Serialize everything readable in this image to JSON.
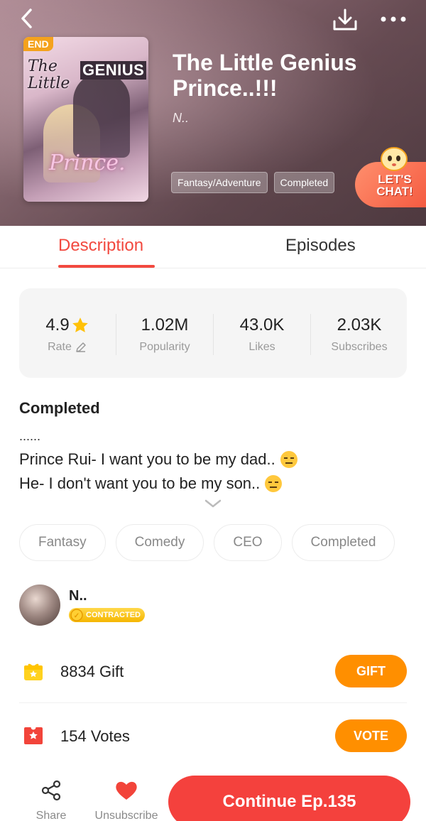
{
  "header": {
    "end_badge": "END",
    "cover_script": "The\nLittle",
    "cover_genius": "GENIUS",
    "cover_prince": "Prince.",
    "title": "The Little Genius Prince..!!!",
    "author": "N..",
    "genres": [
      "Fantasy/Adventure",
      "Completed"
    ],
    "chat_label": "LET'S CHAT!",
    "icons": [
      "back-icon",
      "download-icon",
      "more-icon"
    ]
  },
  "tabs": {
    "description": "Description",
    "episodes": "Episodes",
    "active": "Description"
  },
  "stats": {
    "rate": {
      "value": "4.9",
      "label": "Rate"
    },
    "popularity": {
      "value": "1.02M",
      "label": "Popularity"
    },
    "likes": {
      "value": "43.0K",
      "label": "Likes"
    },
    "subscribes": {
      "value": "2.03K",
      "label": "Subscribes"
    }
  },
  "description": {
    "status": "Completed",
    "dots": "......",
    "line1": "Prince Rui- I want you to be my dad..",
    "line2": "He- I don't want you to be my son.."
  },
  "tags": [
    "Fantasy",
    "Comedy",
    "CEO",
    "Completed"
  ],
  "author": {
    "name": "N..",
    "badge": "CONTRACTED"
  },
  "gift": {
    "label": "8834 Gift",
    "button": "GIFT"
  },
  "vote": {
    "label": "154 Votes",
    "button": "VOTE"
  },
  "bottom": {
    "share": "Share",
    "unsubscribe": "Unsubscribe",
    "continue": "Continue Ep.135"
  },
  "colors": {
    "accent": "#f2493f",
    "orange": "#ff8f00",
    "star": "#ffc107",
    "continue": "#f4413d"
  }
}
